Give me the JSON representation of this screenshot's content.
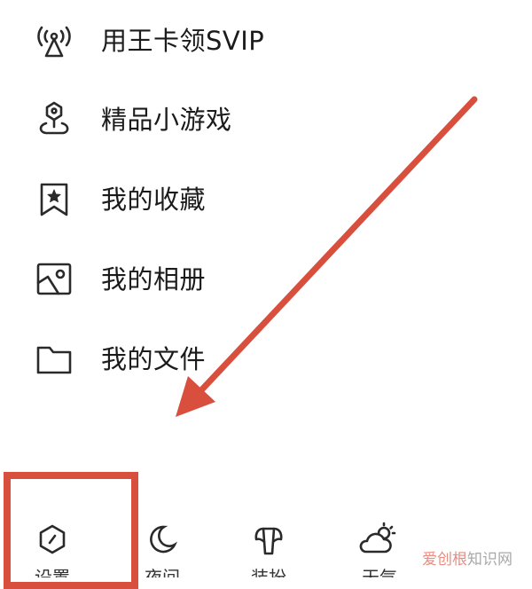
{
  "menu": {
    "items": [
      {
        "label": "用王卡领SVIP",
        "icon": "signal-tower-icon"
      },
      {
        "label": "精品小游戏",
        "icon": "game-pin-icon"
      },
      {
        "label": "我的收藏",
        "icon": "bookmark-star-icon"
      },
      {
        "label": "我的相册",
        "icon": "photo-album-icon"
      },
      {
        "label": "我的文件",
        "icon": "folder-icon"
      }
    ]
  },
  "bottom_bar": {
    "items": [
      {
        "label": "设置",
        "icon": "settings-hexagon-icon"
      },
      {
        "label": "夜间",
        "icon": "moon-icon"
      },
      {
        "label": "装扮",
        "icon": "winged-shirt-icon"
      },
      {
        "label": "天气",
        "icon": "sun-cloud-icon"
      }
    ]
  },
  "annotation": {
    "arrow_color": "#d94f3e",
    "box_color": "#d94f3e"
  },
  "watermark": {
    "brand": "爱创根",
    "suffix": "知识网"
  }
}
